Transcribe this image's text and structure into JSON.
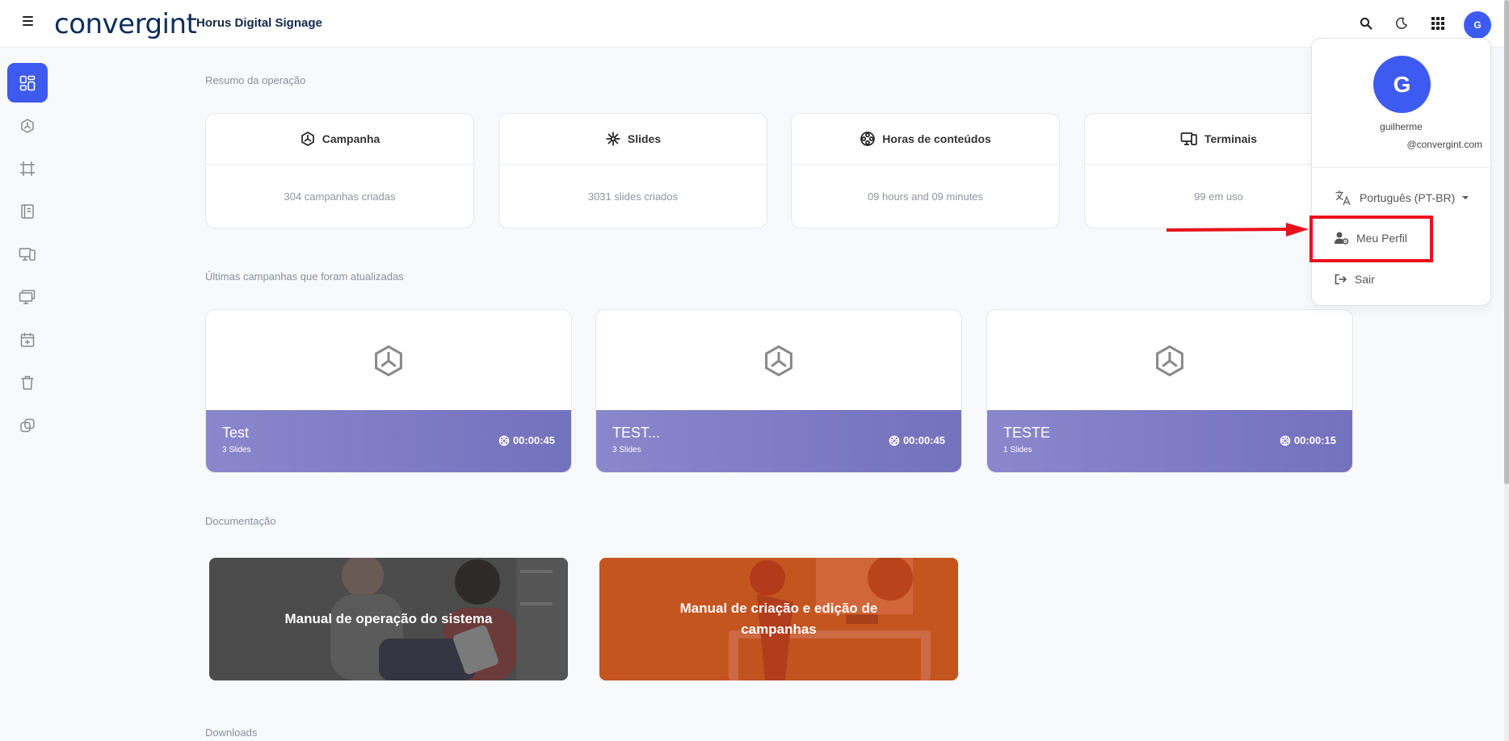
{
  "header": {
    "logo_text": "convergint",
    "app_title": "Horus Digital Signage",
    "avatar_initial": "G"
  },
  "sidebar": {
    "items": [
      {
        "name": "dashboard",
        "icon": "dashboard-icon",
        "active": true
      },
      {
        "name": "campaigns",
        "icon": "campaign-icon"
      },
      {
        "name": "frames",
        "icon": "frame-icon"
      },
      {
        "name": "documents",
        "icon": "notebook-icon"
      },
      {
        "name": "terminals",
        "icon": "devices-icon"
      },
      {
        "name": "screens",
        "icon": "monitors-icon"
      },
      {
        "name": "schedule",
        "icon": "calendar-plus-icon"
      },
      {
        "name": "trash",
        "icon": "trash-icon"
      },
      {
        "name": "integrations",
        "icon": "link-icon"
      }
    ]
  },
  "summary": {
    "section_title": "Resumo da operação",
    "cards": [
      {
        "title": "Campanha",
        "value": "304 campanhas criadas",
        "icon": "campaign-icon"
      },
      {
        "title": "Slides",
        "value": "3031 slides criados",
        "icon": "sparkle-icon"
      },
      {
        "title": "Horas de conteúdos",
        "value": "09 hours and 09 minutes",
        "icon": "film-reel-icon"
      },
      {
        "title": "Terminais",
        "value": "99 em uso",
        "icon": "devices-icon"
      }
    ]
  },
  "recent": {
    "section_title": "Últimas campanhas que foram atualizadas",
    "campaigns": [
      {
        "name": "Test",
        "slides": "3 Slides",
        "duration": "00:00:45"
      },
      {
        "name": "TEST...",
        "slides": "3 Slides",
        "duration": "00:00:45"
      },
      {
        "name": "TESTE",
        "slides": "1 Slides",
        "duration": "00:00:15"
      }
    ]
  },
  "docs": {
    "section_title": "Documentação",
    "items": [
      {
        "title": "Manual de operação do sistema",
        "color": "#4a4a4a"
      },
      {
        "title": "Manual de criação e edição de campanhas",
        "color": "#c2531e"
      }
    ]
  },
  "downloads": {
    "section_title": "Downloads"
  },
  "user_menu": {
    "avatar_initial": "G",
    "username": "guilherme",
    "email": "@convergint.com",
    "language": "Português (PT-BR)",
    "profile_label": "Meu Perfil",
    "logout_label": "Sair"
  },
  "colors": {
    "accent": "#3d5af1",
    "campaign_bar": "#7f7bc5",
    "annotation": "#e8121b"
  }
}
